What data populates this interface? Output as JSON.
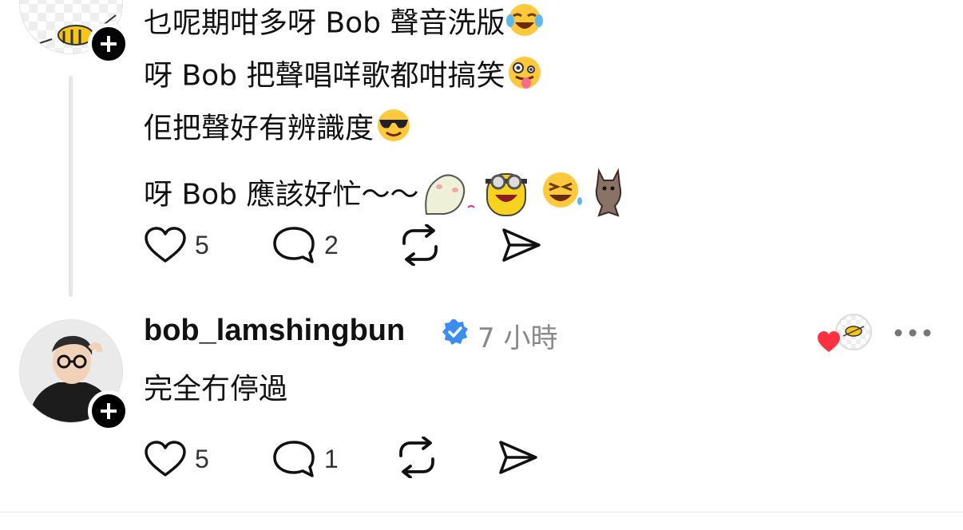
{
  "post1": {
    "lines": [
      "乜呢期咁多呀 Bob 聲音洗版",
      "呀 Bob 把聲唱咩歌都咁搞笑",
      "佢把聲好有辨識度",
      "呀 Bob 應該好忙～～"
    ],
    "line_emojis": [
      "face-with-tears-of-joy",
      "zany-face",
      "smiling-face-with-sunglasses",
      "sticker-set"
    ],
    "likes": "5",
    "replies": "2"
  },
  "reply": {
    "username": "bob_lamshingbun",
    "verified": true,
    "timestamp": "7 小時",
    "text": "完全冇停過",
    "likes": "5",
    "replies": "1",
    "liked_by_icon": "heart-icon"
  },
  "colors": {
    "verified_blue": "#3b8df0",
    "heart_red": "#ff3040",
    "muted_text": "#888888"
  }
}
